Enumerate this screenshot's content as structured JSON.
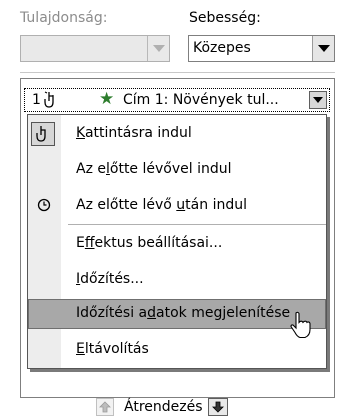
{
  "property": {
    "label": "Tulajdonság:",
    "value": ""
  },
  "speed": {
    "label": "Sebesség:",
    "value": "Közepes"
  },
  "animation_item": {
    "number": "1",
    "text": "Cím 1: Növények tul..."
  },
  "menu": {
    "items": [
      {
        "label_pre": "",
        "label_u": "K",
        "label_post": "attintásra indul"
      },
      {
        "label_pre": "Az e",
        "label_u": "l",
        "label_post": "őtte lévővel indul"
      },
      {
        "label_pre": "Az előtte lévő ",
        "label_u": "u",
        "label_post": "tán indul"
      },
      {
        "label_pre": "E",
        "label_u": "f",
        "label_post": "fektus beállításai..."
      },
      {
        "label_pre": "",
        "label_u": "I",
        "label_post": "dőzítés..."
      },
      {
        "label_pre": "Időzítési a",
        "label_u": "d",
        "label_post": "atok megjelenítése"
      },
      {
        "label_pre": "",
        "label_u": "E",
        "label_post": "ltávolítás"
      }
    ]
  },
  "reorder": {
    "label": "Átrendezés"
  },
  "colors": {
    "hover": "#a8a8a8",
    "icon_column": "#ededed",
    "star": "#2d7d2d"
  }
}
